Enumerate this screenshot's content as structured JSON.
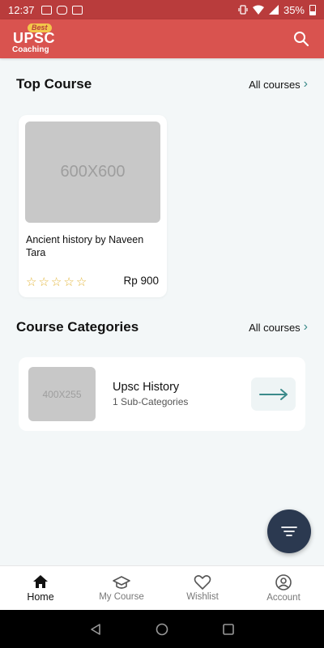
{
  "status_bar": {
    "time": "12:37",
    "battery": "35%",
    "notification_icons": [
      "app-notification-icon",
      "instagram-icon",
      "paytm-icon"
    ]
  },
  "app_bar": {
    "logo": {
      "line1": "Best",
      "line2": "UPSC",
      "line3": "Coaching"
    },
    "search_icon": "search-icon",
    "color": "#d9534f"
  },
  "top_course": {
    "title": "Top Course",
    "all_link": "All courses",
    "courses": [
      {
        "thumbnail_text": "600X600",
        "title": "Ancient history by Naveen Tara",
        "rating": 0,
        "max_rating": 5,
        "price": "Rp 900"
      }
    ]
  },
  "course_categories": {
    "title": "Course Categories",
    "all_link": "All courses",
    "categories": [
      {
        "thumbnail_text": "400X255",
        "title": "Upsc History",
        "subtitle": "1 Sub-Categories"
      }
    ]
  },
  "fab": {
    "icon": "filter-icon",
    "color": "#2b3950"
  },
  "bottom_nav": {
    "items": [
      {
        "label": "Home",
        "icon": "home-icon",
        "active": true
      },
      {
        "label": "My Course",
        "icon": "graduation-cap-icon",
        "active": false
      },
      {
        "label": "Wishlist",
        "icon": "heart-icon",
        "active": false
      },
      {
        "label": "Account",
        "icon": "account-icon",
        "active": false
      }
    ]
  },
  "colors": {
    "accent": "#3b8a8a",
    "star": "#e3b63c",
    "background": "#f3f7f8"
  }
}
